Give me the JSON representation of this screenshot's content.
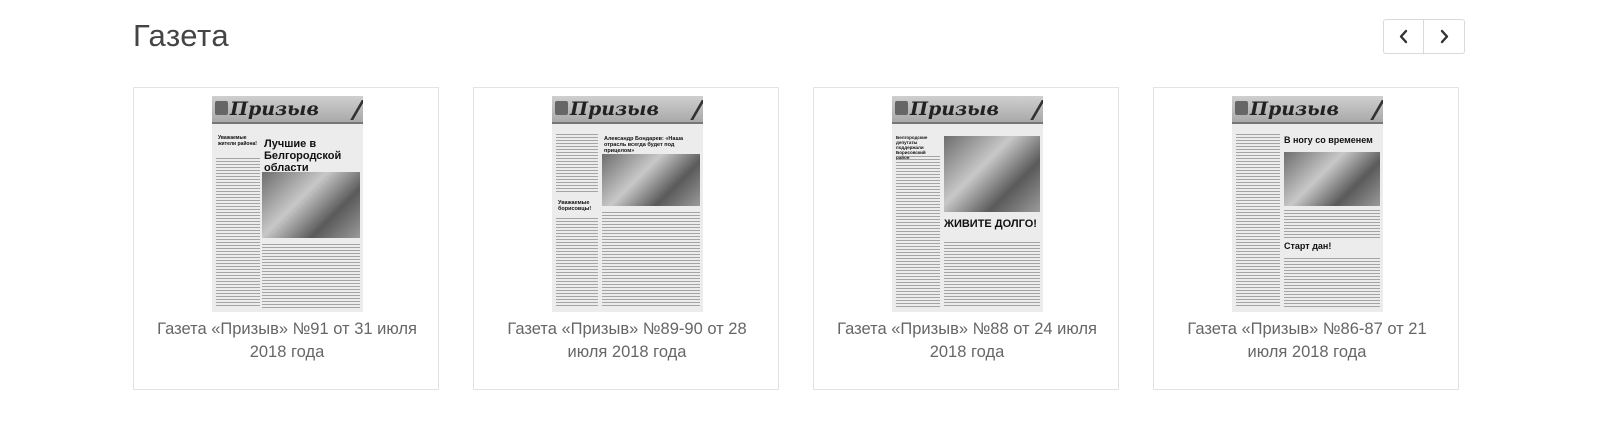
{
  "section": {
    "title": "Газета"
  },
  "nav": {
    "prev_icon": "chevron-left-icon",
    "next_icon": "chevron-right-icon"
  },
  "issues": [
    {
      "caption": "Газета «Призыв» №91 от 31 июля 2018 года",
      "cover_masthead": "Призыв",
      "cover_headline": "Лучшие в Белгородской области",
      "cover_subhead": "Уважаемые жители района!"
    },
    {
      "caption": "Газета «Призыв» №89-90 от 28 июля 2018 года",
      "cover_masthead": "Призыв",
      "cover_headline": "Александр Бондарев: «Наша отрасль всегда будет под прицелом»",
      "cover_subhead": "Уважаемые борисовцы!"
    },
    {
      "caption": "Газета «Призыв» №88 от 24 июля 2018 года",
      "cover_masthead": "Призыв",
      "cover_headline": "ЖИВИТЕ ДОЛГО!",
      "cover_subhead": "Белгородские депутаты поддержали Борисовский район"
    },
    {
      "caption": "Газета «Призыв» №86-87 от 21 июля 2018 года",
      "cover_masthead": "Призыв",
      "cover_headline": "В ногу со временем",
      "cover_subhead": "Старт дан!"
    }
  ]
}
